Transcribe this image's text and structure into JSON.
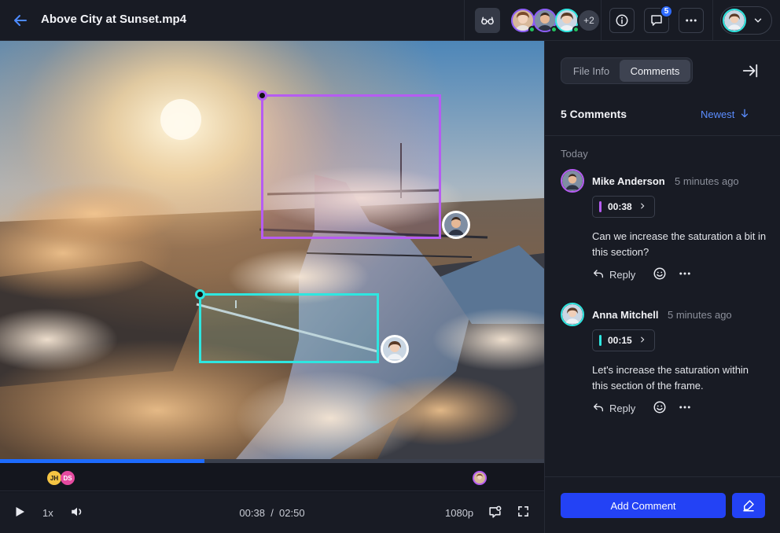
{
  "header": {
    "title": "Above City at Sunset.mp4",
    "extra_viewers": "+2",
    "comment_badge": "5",
    "icons": [
      "back-arrow-icon",
      "glasses-icon",
      "info-icon",
      "comment-icon",
      "more-icon",
      "chevron-down-icon"
    ]
  },
  "player": {
    "speed": "1x",
    "current_time": "00:38",
    "separator": "/",
    "duration": "02:50",
    "quality": "1080p",
    "progress": 0.376,
    "timeline_markers": [
      {
        "initials": "JH",
        "color": "#f5c443"
      },
      {
        "initials": "DS",
        "color": "#e64aa0"
      }
    ],
    "annotations": [
      {
        "author": "Mike Anderson",
        "color": "#b65cf2"
      },
      {
        "author": "Anna Mitchell",
        "color": "#2ee6e0"
      }
    ]
  },
  "panel": {
    "tabs": [
      "File Info",
      "Comments"
    ],
    "active_tab": "Comments",
    "count_label": "5 Comments",
    "sort_label": "Newest",
    "section": "Today",
    "comments": [
      {
        "author": "Mike Anderson",
        "time": "5 minutes ago",
        "timestamp": "00:38",
        "color": "#b65cf2",
        "text": "Can we increase the saturation a bit in this section?",
        "reply_label": "Reply"
      },
      {
        "author": "Anna Mitchell",
        "time": "5 minutes ago",
        "timestamp": "00:15",
        "color": "#2ee6e0",
        "text": "Let's increase the saturation within this section of the frame.",
        "reply_label": "Reply"
      }
    ],
    "add_comment_label": "Add Comment"
  }
}
